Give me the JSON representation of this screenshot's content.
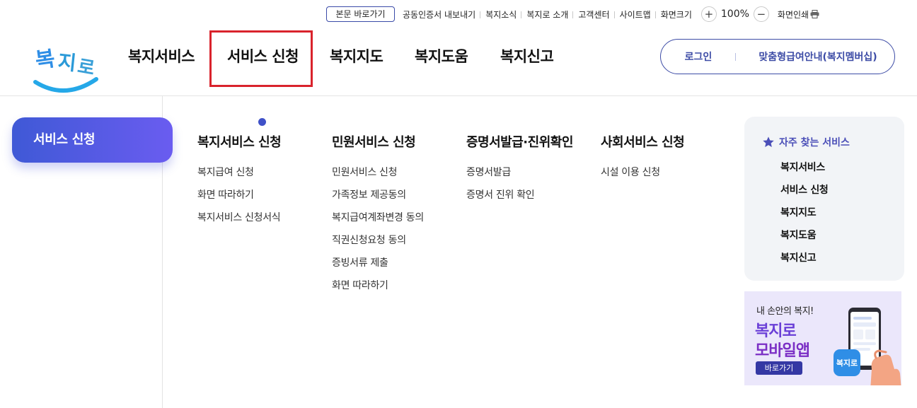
{
  "utility": {
    "skip_link": "본문 바로가기",
    "links": [
      "공동인증서 내보내기",
      "복지소식",
      "복지로 소개",
      "고객센터",
      "사이트맵",
      "화면크기"
    ],
    "zoom_in": "+",
    "zoom_value": "100%",
    "zoom_out": "−",
    "print_label": "화면인쇄"
  },
  "logo": {
    "text": "복지로"
  },
  "gnb": {
    "items": [
      "복지서비스",
      "서비스 신청",
      "복지지도",
      "복지도움",
      "복지신고"
    ],
    "active_index": 1
  },
  "auth": {
    "login": "로그인",
    "membership": "맞춤형급여안내(복지멤버십)"
  },
  "side": {
    "title": "서비스 신청"
  },
  "menu_columns": [
    {
      "heading": "복지서비스 신청",
      "items": [
        "복지급여 신청",
        "화면 따라하기",
        "복지서비스 신청서식"
      ]
    },
    {
      "heading": "민원서비스 신청",
      "items": [
        "민원서비스 신청",
        "가족정보 제공동의",
        "복지급여계좌변경 동의",
        "직권신청요청 동의",
        "증빙서류 제출",
        "화면 따라하기"
      ]
    },
    {
      "heading": "증명서발급·진위확인",
      "items": [
        "증명서발급",
        "증명서 진위 확인"
      ]
    },
    {
      "heading": "사회서비스 신청",
      "items": [
        "시설 이용 신청"
      ]
    }
  ],
  "favorites": {
    "title": "자주 찾는 서비스",
    "items": [
      "복지서비스",
      "서비스 신청",
      "복지지도",
      "복지도움",
      "복지신고"
    ]
  },
  "banner": {
    "tagline": "내 손안의 복지!",
    "line1": "복지로",
    "line2": "모바일앱",
    "button": "바로가기",
    "app_icon_text": "복지로"
  },
  "colors": {
    "primary": "#3d4ca6",
    "accent_purple": "#6a5cf0",
    "highlight_red": "#d9232c"
  }
}
